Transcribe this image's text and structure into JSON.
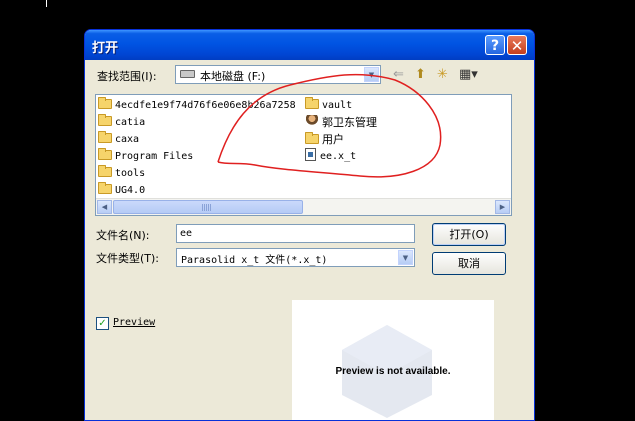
{
  "window": {
    "title": "打开",
    "help_glyph": "?",
    "close_glyph": "✕"
  },
  "lookin": {
    "label": "查找范围(I):",
    "value": "本地磁盘 (F:)"
  },
  "toolbar": {
    "back_glyph": "⇐",
    "up_glyph": "⬆",
    "new_folder_glyph": "✳",
    "views_glyph": "▦▾"
  },
  "files": [
    {
      "name": "4ecdfe1e9f74d76f6e06e8b26a7258",
      "icon": "folder-icon"
    },
    {
      "name": "catia",
      "icon": "folder-icon"
    },
    {
      "name": "caxa",
      "icon": "folder-icon"
    },
    {
      "name": "Program Files",
      "icon": "folder-icon"
    },
    {
      "name": "tools",
      "icon": "folder-icon"
    },
    {
      "name": "UG4.0",
      "icon": "folder-icon"
    },
    {
      "name": "vault",
      "icon": "folder-icon"
    },
    {
      "name": "郭卫东管理",
      "icon": "user-folder-icon"
    },
    {
      "name": "用户",
      "icon": "folder-icon"
    },
    {
      "name": "ee.x_t",
      "icon": "parasolid-file-icon"
    }
  ],
  "filename": {
    "label": "文件名(N):",
    "value": "ee"
  },
  "filetype": {
    "label": "文件类型(T):",
    "value": "Parasolid x_t 文件(*.x_t)"
  },
  "buttons": {
    "open": "打开(O)",
    "cancel": "取消"
  },
  "preview": {
    "checkbox_label": "Preview",
    "checked_glyph": "✓",
    "message": "Preview is not available."
  },
  "colors": {
    "title_bar": "#0054e3",
    "dialog_bg": "#ece9d8",
    "annotation_stroke": "#e02020"
  }
}
